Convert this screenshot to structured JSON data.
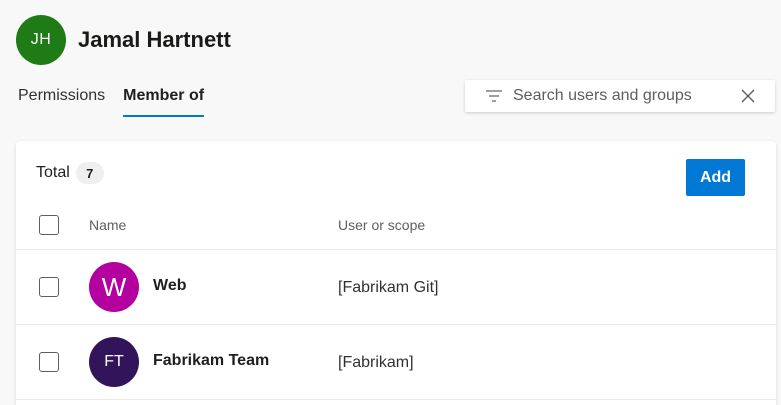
{
  "user": {
    "initials": "JH",
    "name": "Jamal Hartnett",
    "avatar_color": "#1e7b15"
  },
  "tabs": [
    {
      "label": "Permissions",
      "active": false
    },
    {
      "label": "Member of",
      "active": true
    }
  ],
  "search": {
    "placeholder": "Search users and groups",
    "value": "",
    "filter_icon": "filter-icon",
    "clear_icon": "close-icon"
  },
  "card": {
    "total_label": "Total",
    "total_count": "7",
    "add_label": "Add",
    "columns": {
      "name": "Name",
      "scope": "User or scope"
    },
    "rows": [
      {
        "initials": "W",
        "name": "Web",
        "scope": "[Fabrikam Git]",
        "avatar_color": "#b4009e"
      },
      {
        "initials": "FT",
        "name": "Fabrikam Team",
        "scope": "[Fabrikam]",
        "avatar_color": "#32145a"
      }
    ]
  },
  "colors": {
    "accent": "#0078d4"
  }
}
